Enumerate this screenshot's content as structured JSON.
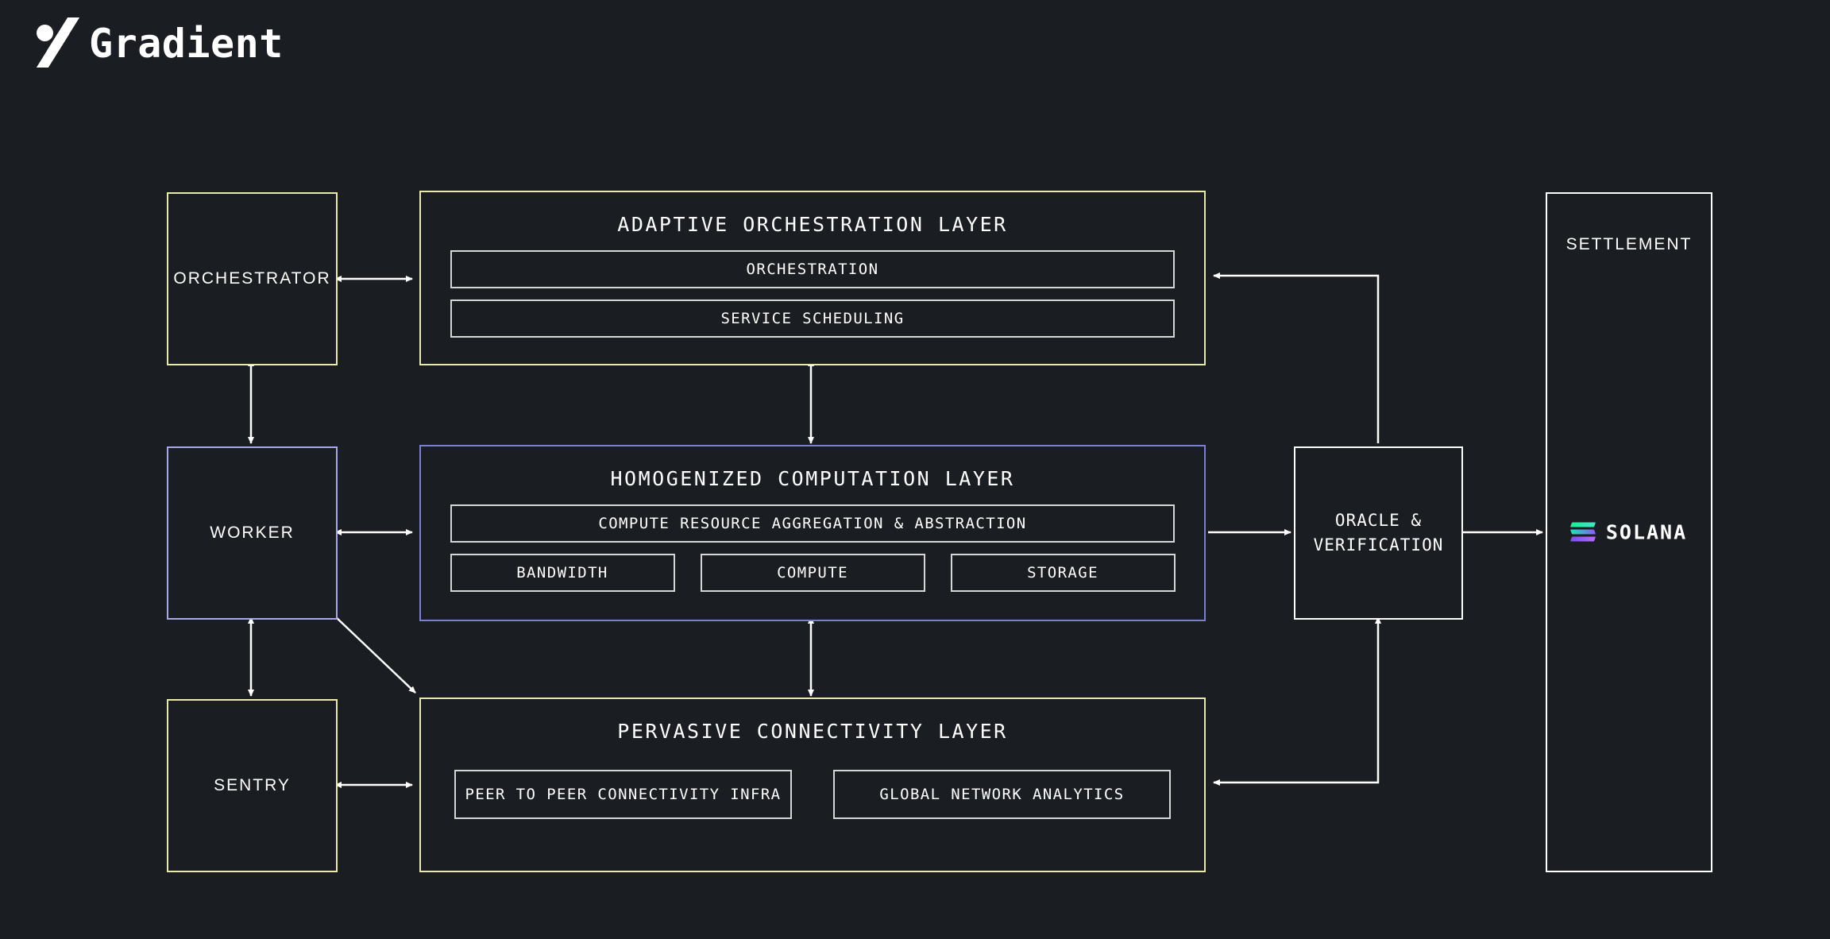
{
  "brand": {
    "name": "Gradient",
    "logo_icon": "gradient-logo-icon"
  },
  "colors": {
    "background": "#1a1d21",
    "white": "#ffffff",
    "yellow_border": "#e8e8b0",
    "purple_border": "#a6a8e8",
    "sub_border": "#d6d6d6",
    "solana_green": "#14f195",
    "solana_purple": "#7c4ef3"
  },
  "nodes": {
    "orchestrator": {
      "label": "ORCHESTRATOR",
      "border": "#e8e8b0"
    },
    "worker": {
      "label": "WORKER",
      "border": "#a6a8e8"
    },
    "sentry": {
      "label": "SENTRY",
      "border": "#e8e8b0"
    },
    "oracle": {
      "label_line1": "ORACLE &",
      "label_line2": "VERIFICATION",
      "border": "#ffffff"
    },
    "settlement": {
      "label": "SETTLEMENT",
      "border": "#ffffff",
      "chain": "SOLANA",
      "chain_icon": "solana-logo-icon"
    }
  },
  "layers": [
    {
      "id": "orchestration",
      "title": "ADAPTIVE ORCHESTRATION LAYER",
      "border": "#e8e8b0",
      "rows": [
        {
          "items": [
            {
              "label": "ORCHESTRATION"
            }
          ]
        },
        {
          "items": [
            {
              "label": "SERVICE SCHEDULING"
            }
          ]
        }
      ]
    },
    {
      "id": "computation",
      "title": "HOMOGENIZED COMPUTATION LAYER",
      "border": "#7b7fd4",
      "rows": [
        {
          "items": [
            {
              "label": "COMPUTE RESOURCE AGGREGATION & ABSTRACTION"
            }
          ]
        },
        {
          "items": [
            {
              "label": "BANDWIDTH"
            },
            {
              "label": "COMPUTE"
            },
            {
              "label": "STORAGE"
            }
          ]
        }
      ]
    },
    {
      "id": "connectivity",
      "title": "PERVASIVE CONNECTIVITY LAYER",
      "border": "#e8e8b0",
      "rows": [
        {
          "items": [
            {
              "label": "PEER TO PEER CONNECTIVITY INFRA"
            },
            {
              "label": "GLOBAL NETWORK ANALYTICS"
            }
          ]
        }
      ]
    }
  ]
}
